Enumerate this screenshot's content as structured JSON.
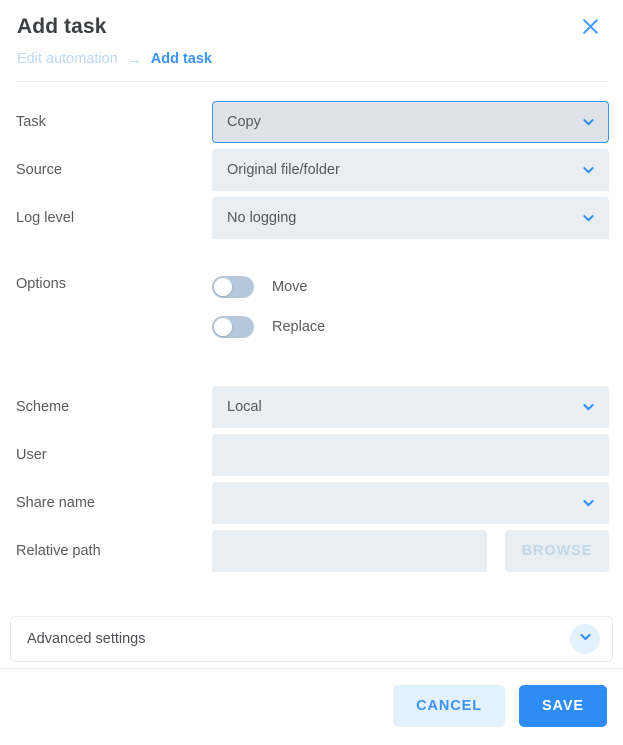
{
  "header": {
    "title": "Add task",
    "close_icon": "close-icon",
    "breadcrumb": {
      "parent": "Edit automation",
      "separator": "→",
      "current": "Add task"
    }
  },
  "form": {
    "task": {
      "label": "Task",
      "value": "Copy",
      "focused": true,
      "icon": "chevron-down-icon"
    },
    "source": {
      "label": "Source",
      "value": "Original file/folder",
      "icon": "chevron-down-icon"
    },
    "log_level": {
      "label": "Log level",
      "value": "No logging",
      "icon": "chevron-down-icon"
    },
    "options": {
      "label": "Options",
      "toggles": [
        {
          "label": "Move",
          "on": false
        },
        {
          "label": "Replace",
          "on": false
        }
      ]
    },
    "scheme": {
      "label": "Scheme",
      "value": "Local",
      "icon": "chevron-down-icon"
    },
    "user": {
      "label": "User",
      "value": "",
      "placeholder": ""
    },
    "share_name": {
      "label": "Share name",
      "value": "",
      "icon": "chevron-down-icon"
    },
    "relative_path": {
      "label": "Relative path",
      "value": "",
      "placeholder": "",
      "browse_label": "BROWSE",
      "browse_disabled": true
    }
  },
  "advanced": {
    "label": "Advanced settings",
    "expanded": false,
    "icon": "chevron-down-icon"
  },
  "footer": {
    "cancel_label": "CANCEL",
    "save_label": "SAVE"
  },
  "colors": {
    "accent": "#2d8cf5",
    "link": "#3d93f2",
    "link_muted": "#bcd9f7",
    "field_bg": "#e9eef3",
    "field_bg_focused": "#dde3e9",
    "toggle_track": "#b6c9dc",
    "label_text": "#5a5a5c",
    "title_text": "#3c4043"
  }
}
